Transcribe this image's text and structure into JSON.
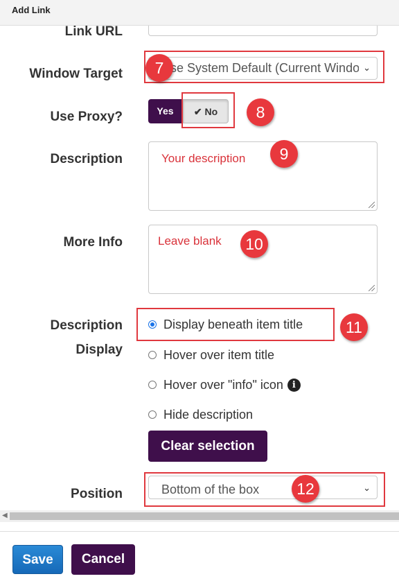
{
  "dialog": {
    "title": "Add Link"
  },
  "form": {
    "link_url": {
      "label": "Link URL",
      "value": ""
    },
    "window_target": {
      "label": "Window Target",
      "selected": "Use System Default (Current Window)"
    },
    "use_proxy": {
      "label": "Use Proxy?",
      "yes_label": "Yes",
      "no_label": "No",
      "selected": "No"
    },
    "description": {
      "label": "Description",
      "value": "Your description"
    },
    "more_info": {
      "label": "More Info",
      "value": "Leave blank"
    },
    "description_display": {
      "label_line1": "Description",
      "label_line2": "Display",
      "options": [
        {
          "label": "Display beneath item title",
          "checked": true
        },
        {
          "label": "Hover over item title",
          "checked": false
        },
        {
          "label": "Hover over \"info\" icon",
          "checked": false
        },
        {
          "label": "Hide description",
          "checked": false
        }
      ],
      "clear_label": "Clear selection"
    },
    "position": {
      "label": "Position",
      "selected": "Bottom of the box"
    }
  },
  "annotations": [
    "7",
    "8",
    "9",
    "10",
    "11",
    "12"
  ],
  "footer": {
    "save_label": "Save",
    "cancel_label": "Cancel"
  },
  "colors": {
    "primary_purple": "#3f0f4b",
    "save_blue": "#1a73c9",
    "annotation_red": "#e8383d"
  },
  "icons": {
    "check": "check-icon",
    "info": "info-icon",
    "dropdown": "chevron-down-icon"
  }
}
